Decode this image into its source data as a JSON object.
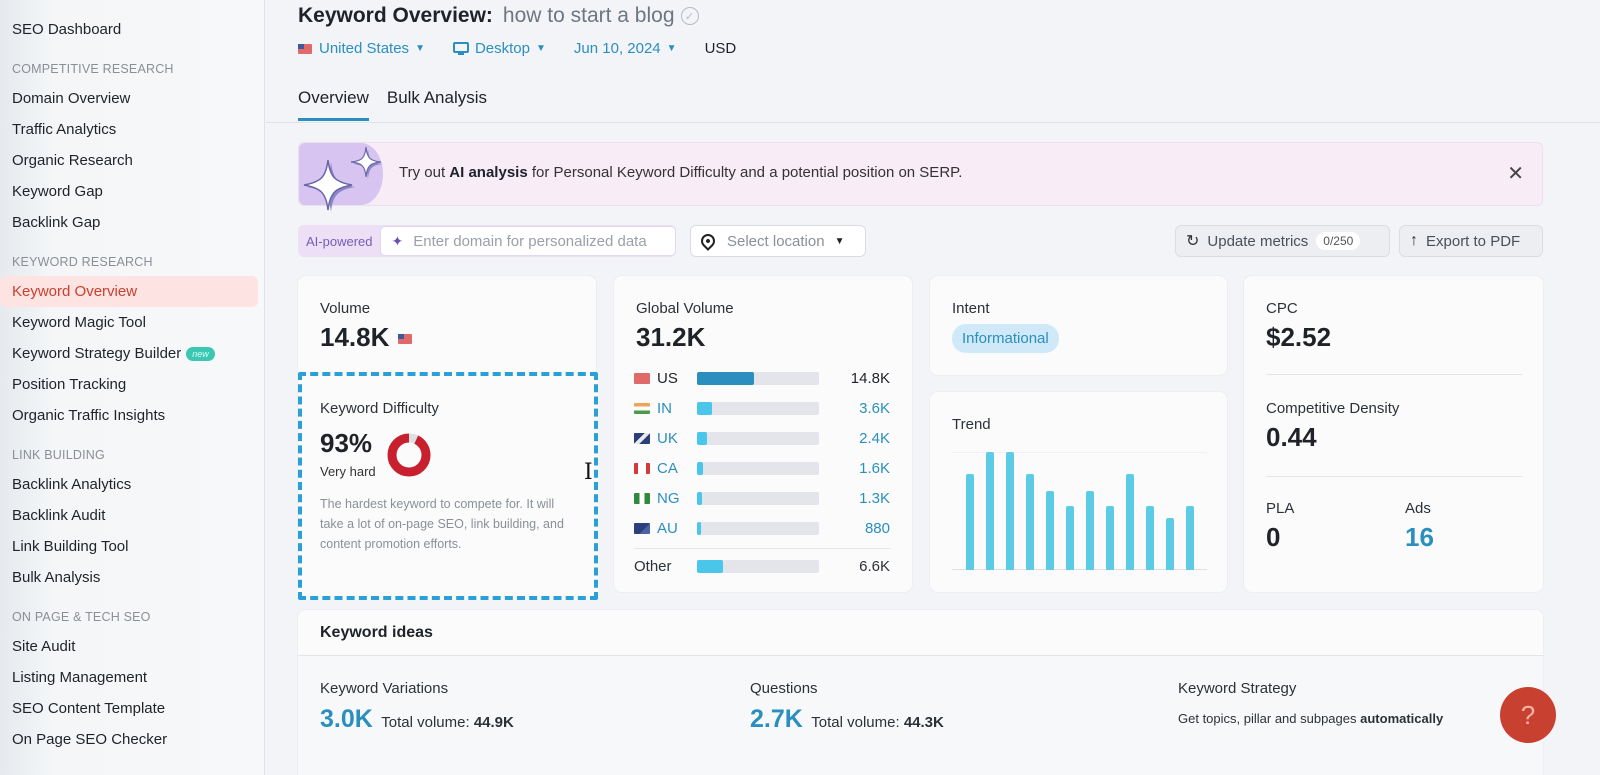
{
  "sidebar": {
    "top": "SEO Dashboard",
    "sections": [
      {
        "title": "COMPETITIVE RESEARCH",
        "items": [
          "Domain Overview",
          "Traffic Analytics",
          "Organic Research",
          "Keyword Gap",
          "Backlink Gap"
        ]
      },
      {
        "title": "KEYWORD RESEARCH",
        "items": [
          "Keyword Overview",
          "Keyword Magic Tool",
          "Keyword Strategy Builder",
          "Position Tracking",
          "Organic Traffic Insights"
        ]
      },
      {
        "title": "LINK BUILDING",
        "items": [
          "Backlink Analytics",
          "Backlink Audit",
          "Link Building Tool",
          "Bulk Analysis"
        ]
      },
      {
        "title": "ON PAGE & TECH SEO",
        "items": [
          "Site Audit",
          "Listing Management",
          "SEO Content Template",
          "On Page SEO Checker"
        ]
      }
    ],
    "active_item": "Keyword Overview",
    "new_badge": "new"
  },
  "header": {
    "title": "Keyword Overview:",
    "keyword": "how to start a blog",
    "country": "United States",
    "device": "Desktop",
    "date": "Jun 10, 2024",
    "currency": "USD"
  },
  "tabs": [
    {
      "label": "Overview",
      "active": true
    },
    {
      "label": "Bulk Analysis",
      "active": false
    }
  ],
  "banner": {
    "prefix": "Try out",
    "bold": "AI analysis",
    "suffix": "for Personal Keyword Difficulty and a potential position on SERP."
  },
  "ai": {
    "label": "AI-powered",
    "domain_placeholder": "Enter domain for personalized data",
    "location_placeholder": "Select location"
  },
  "actions": {
    "update_label": "Update metrics",
    "update_counter": "0/250",
    "export_label": "Export to PDF"
  },
  "volume": {
    "label": "Volume",
    "value": "14.8K"
  },
  "difficulty": {
    "label": "Keyword Difficulty",
    "value": "93%",
    "percent": 93,
    "level": "Very hard",
    "description": "The hardest keyword to compete for. It will take a lot of on-page SEO, link building, and content promotion efforts.",
    "color": "#c8202f"
  },
  "global_volume": {
    "label": "Global Volume",
    "value": "31.2K",
    "rows": [
      {
        "code": "US",
        "value": "14.8K",
        "share": 0.47,
        "highlight": true
      },
      {
        "code": "IN",
        "value": "3.6K",
        "share": 0.12
      },
      {
        "code": "UK",
        "value": "2.4K",
        "share": 0.08
      },
      {
        "code": "CA",
        "value": "1.6K",
        "share": 0.05
      },
      {
        "code": "NG",
        "value": "1.3K",
        "share": 0.04
      },
      {
        "code": "AU",
        "value": "880",
        "share": 0.03
      }
    ],
    "other": {
      "label": "Other",
      "value": "6.6K",
      "share": 0.21
    }
  },
  "intent": {
    "label": "Intent",
    "value": "Informational"
  },
  "trend": {
    "label": "Trend",
    "values": [
      0.81,
      1.0,
      1.0,
      0.81,
      0.67,
      0.54,
      0.67,
      0.54,
      0.81,
      0.54,
      0.44,
      0.54
    ]
  },
  "cpc": {
    "label": "CPC",
    "value": "$2.52"
  },
  "density": {
    "label": "Competitive Density",
    "value": "0.44"
  },
  "pla": {
    "label": "PLA",
    "value": "0"
  },
  "ads": {
    "label": "Ads",
    "value": "16"
  },
  "keyword_ideas": {
    "title": "Keyword ideas",
    "variations": {
      "label": "Keyword Variations",
      "value": "3.0K",
      "total_label": "Total volume:",
      "total": "44.9K"
    },
    "questions": {
      "label": "Questions",
      "value": "2.7K",
      "total_label": "Total volume:",
      "total": "44.3K"
    },
    "strategy": {
      "label": "Keyword Strategy",
      "text": "Get topics, pillar and subpages",
      "bold": "automatically"
    }
  },
  "help": {
    "label": "?"
  }
}
